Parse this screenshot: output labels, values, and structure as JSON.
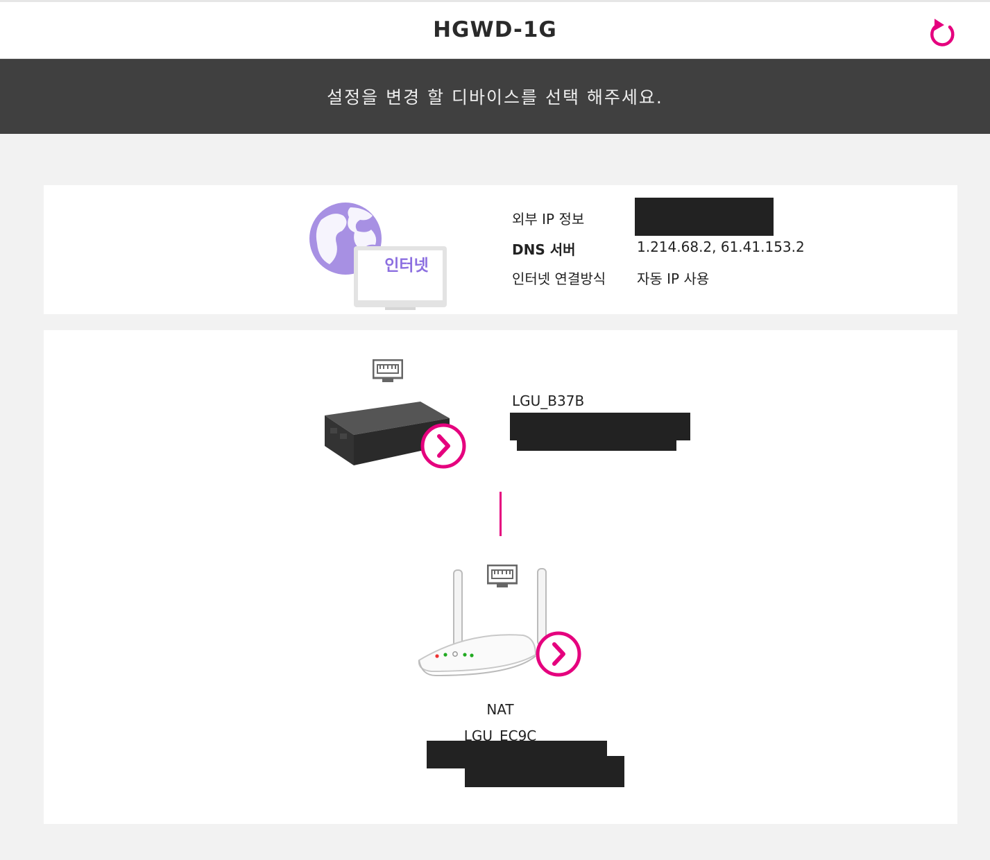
{
  "header": {
    "title": "HGWD-1G",
    "refresh_icon": "refresh-icon",
    "accent_color": "#e5007e"
  },
  "banner": {
    "text": "설정을 변경 할 디바이스를 선택 해주세요."
  },
  "internet": {
    "icon_label": "인터넷",
    "rows": [
      {
        "label": "외부 IP 정보",
        "value": ""
      },
      {
        "label": "DNS 서버",
        "value": "1.214.68.2, 61.41.153.2"
      },
      {
        "label": "인터넷 연결방식",
        "value": "자동 IP 사용"
      }
    ]
  },
  "devices": [
    {
      "name": "LGU_B37B",
      "type_label": "",
      "icon": "switch-device",
      "port_icon": "ethernet-port-icon",
      "action_icon": "chevron-right-icon"
    },
    {
      "name": "LGU_EC9C",
      "type_label": "NAT",
      "icon": "wifi-router-device",
      "port_icon": "ethernet-port-icon",
      "action_icon": "chevron-right-icon"
    }
  ]
}
